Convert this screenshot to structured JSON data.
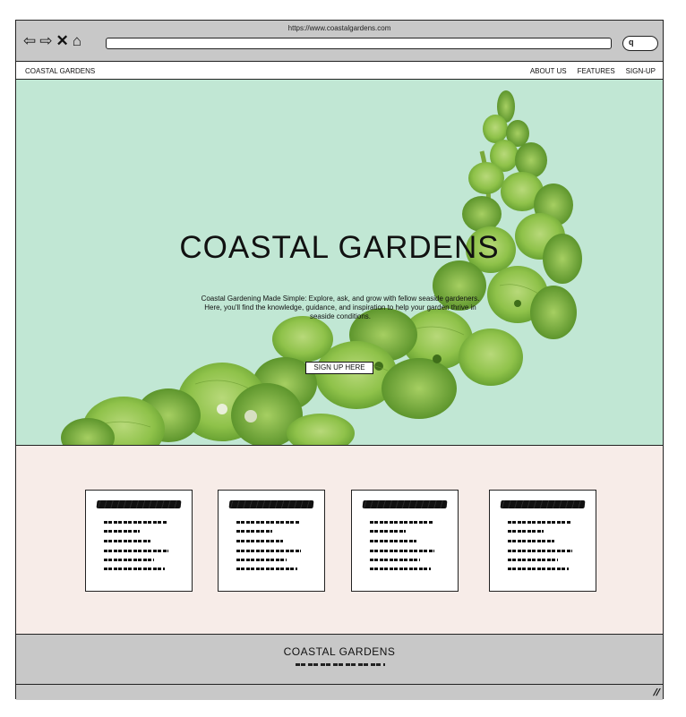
{
  "browser": {
    "url": "https://www.coastalgardens.com",
    "icons": [
      "back-arrow-icon",
      "forward-arrow-icon",
      "close-icon",
      "home-icon",
      "search-icon"
    ]
  },
  "nav": {
    "brand": "COASTAL GARDENS",
    "links": [
      "ABOUT US",
      "FEATURES",
      "SIGN-UP"
    ]
  },
  "hero": {
    "title": "COASTAL GARDENS",
    "subtitle": "Coastal Gardening Made Simple: Explore, ask, and grow with fellow seaside gardeners. Here, you'll find the knowledge, guidance, and inspiration to help your garden thrive in seaside conditions.",
    "button": "SIGN UP HERE",
    "background": "#c1e7d4"
  },
  "features": {
    "background": "#f7ece8",
    "cards": [
      {
        "placeholder": "scribble"
      },
      {
        "placeholder": "scribble"
      },
      {
        "placeholder": "scribble"
      },
      {
        "placeholder": "scribble"
      }
    ]
  },
  "footer": {
    "title": "COASTAL GARDENS",
    "background": "#c8c8c8"
  }
}
